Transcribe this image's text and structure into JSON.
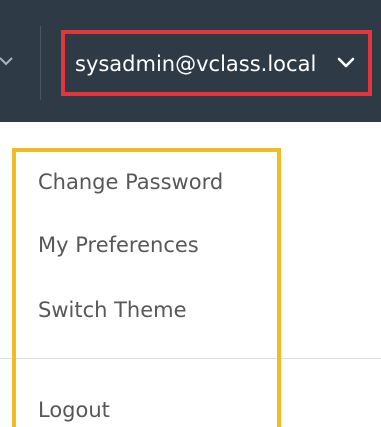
{
  "header": {
    "user_menu": {
      "label": "sysadmin@vclass.local",
      "icon": "chevron-down-icon"
    },
    "left_icon": "chevron-down-icon"
  },
  "dropdown": {
    "items": [
      {
        "label": "Change Password"
      },
      {
        "label": "My Preferences"
      },
      {
        "label": "Switch Theme"
      },
      {
        "label": "Logout"
      }
    ]
  },
  "colors": {
    "header_bg": "#2e3b47",
    "highlight_red": "#e4343c",
    "highlight_yellow": "#f0bc25",
    "menu_text": "#575757"
  }
}
